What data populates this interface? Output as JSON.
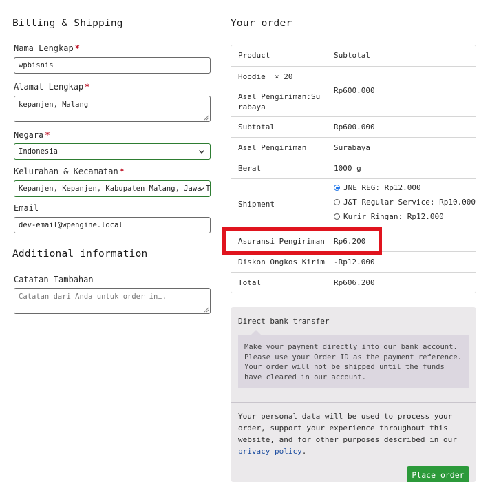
{
  "billing": {
    "title": "Billing & Shipping",
    "required_mark": "*",
    "fields": {
      "name": {
        "label": "Nama Lengkap",
        "value": "wpbisnis"
      },
      "address": {
        "label": "Alamat Lengkap",
        "value": "kepanjen, Malang"
      },
      "country": {
        "label": "Negara",
        "value": "Indonesia"
      },
      "district": {
        "label": "Kelurahan & Kecamatan",
        "value": "Kepanjen, Kepanjen, Kabupaten Malang, Jawa Timur"
      },
      "email": {
        "label": "Email",
        "value": "dev-email@wpengine.local"
      }
    }
  },
  "additional": {
    "title": "Additional information",
    "notes_label": "Catatan Tambahan",
    "notes_placeholder": "Catatan dari Anda untuk order ini."
  },
  "order": {
    "title": "Your order",
    "header": {
      "product": "Product",
      "subtotal": "Subtotal"
    },
    "item": {
      "name": "Hoodie",
      "qty": "× 20",
      "origin_label": "Asal Pengiriman:",
      "origin_value_line1": "Su",
      "origin_value_line2": "rabaya",
      "price": "Rp600.000"
    },
    "rows": {
      "subtotal": {
        "label": "Subtotal",
        "value": "Rp600.000"
      },
      "origin": {
        "label": "Asal Pengiriman",
        "value": "Surabaya"
      },
      "weight": {
        "label": "Berat",
        "value": "1000 g"
      },
      "insurance": {
        "label": "Asuransi Pengiriman",
        "value": "Rp6.200"
      },
      "discount": {
        "label": "Diskon Ongkos Kirim",
        "value": "-Rp12.000"
      },
      "total": {
        "label": "Total",
        "value": "Rp606.200"
      }
    },
    "shipment": {
      "label": "Shipment",
      "options": [
        {
          "label": "JNE REG: Rp12.000",
          "selected": true
        },
        {
          "label": "J&T Regular Service: Rp10.000",
          "selected": false
        },
        {
          "label": "Kurir Ringan: Rp12.000",
          "selected": false
        }
      ]
    }
  },
  "payment": {
    "method": "Direct bank transfer",
    "description": "Make your payment directly into our bank account. Please use your Order ID as the payment reference. Your order will not be shipped until the funds have cleared in our account.",
    "privacy_text": "Your personal data will be used to process your order, support your experience throughout this website, and for other purposes described in our",
    "privacy_link": "privacy policy",
    "privacy_end": ".",
    "place_order": "Place order"
  },
  "colors": {
    "required": "#c0192c",
    "highlight": "#e0141e",
    "button": "#2c9a3a",
    "link": "#1f4fa0",
    "radio_selected": "#1a73e8"
  }
}
